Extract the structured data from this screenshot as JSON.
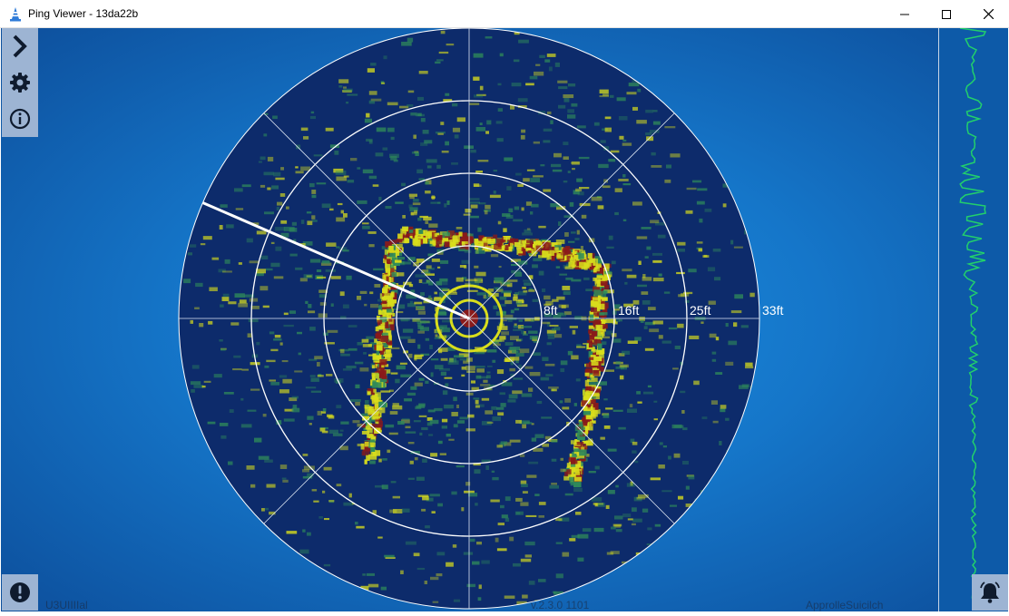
{
  "window": {
    "title": "Ping Viewer - 13da22b"
  },
  "window_controls": {
    "minimize": "—",
    "maximize": "☐",
    "close": "✕"
  },
  "toolbar": {
    "icons": [
      "chevron-right-icon",
      "gear-icon",
      "info-icon"
    ]
  },
  "sonar": {
    "range_labels": [
      "8ft",
      "16ft",
      "25ft",
      "33ft"
    ],
    "scan_angle_deg": 157
  },
  "status": {
    "left": "U3UIIIIal",
    "center": "v.2.3.0 1101",
    "right": "ApprolleSuicilch"
  },
  "colors": {
    "background": "#1576c9",
    "sonar_bg": "#0d2b6b",
    "echo_weak": "#2f8a5a",
    "echo_medium": "#d8dd1c",
    "echo_strong": "#8a1a1a",
    "trace": "#22d06b",
    "toolbar_bg": "#9db4d3"
  }
}
